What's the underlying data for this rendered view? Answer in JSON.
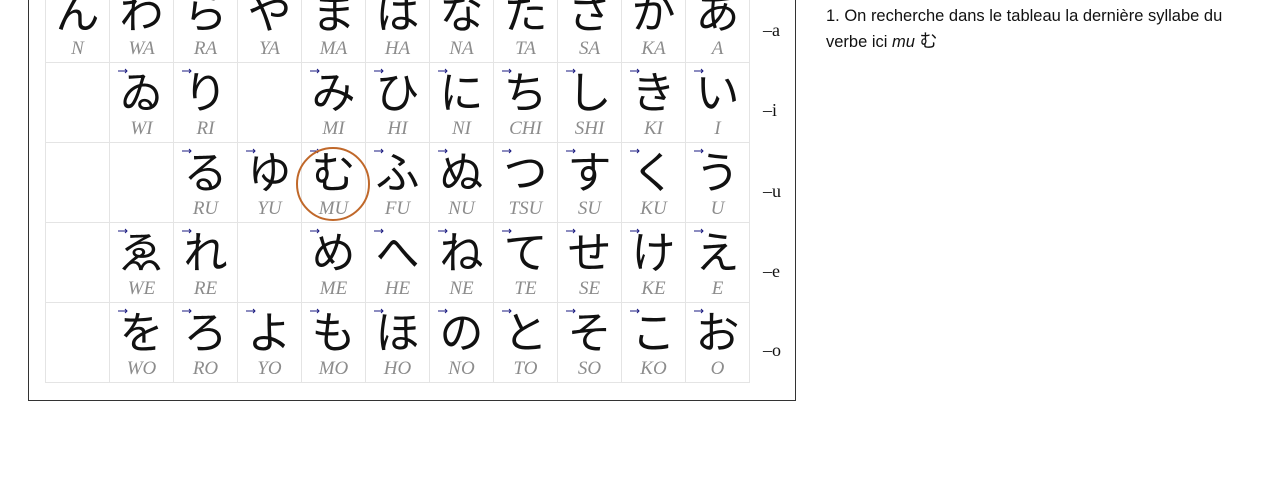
{
  "table": {
    "rows": [
      {
        "label": "–a",
        "cells": [
          {
            "kana": "ん",
            "romaji": "N"
          },
          {
            "kana": "わ",
            "romaji": "WA"
          },
          {
            "kana": "ら",
            "romaji": "RA"
          },
          {
            "kana": "や",
            "romaji": "YA"
          },
          {
            "kana": "ま",
            "romaji": "MA"
          },
          {
            "kana": "は",
            "romaji": "HA"
          },
          {
            "kana": "な",
            "romaji": "NA"
          },
          {
            "kana": "た",
            "romaji": "TA"
          },
          {
            "kana": "さ",
            "romaji": "SA"
          },
          {
            "kana": "か",
            "romaji": "KA"
          },
          {
            "kana": "あ",
            "romaji": "A"
          }
        ]
      },
      {
        "label": "–i",
        "cells": [
          {
            "kana": "",
            "romaji": ""
          },
          {
            "kana": "ゐ",
            "romaji": "WI"
          },
          {
            "kana": "り",
            "romaji": "RI"
          },
          {
            "kana": "",
            "romaji": ""
          },
          {
            "kana": "み",
            "romaji": "MI"
          },
          {
            "kana": "ひ",
            "romaji": "HI"
          },
          {
            "kana": "に",
            "romaji": "NI"
          },
          {
            "kana": "ち",
            "romaji": "CHI"
          },
          {
            "kana": "し",
            "romaji": "SHI"
          },
          {
            "kana": "き",
            "romaji": "KI"
          },
          {
            "kana": "い",
            "romaji": "I"
          }
        ]
      },
      {
        "label": "–u",
        "cells": [
          {
            "kana": "",
            "romaji": ""
          },
          {
            "kana": "",
            "romaji": ""
          },
          {
            "kana": "る",
            "romaji": "RU"
          },
          {
            "kana": "ゆ",
            "romaji": "YU"
          },
          {
            "kana": "む",
            "romaji": "MU"
          },
          {
            "kana": "ふ",
            "romaji": "FU"
          },
          {
            "kana": "ぬ",
            "romaji": "NU"
          },
          {
            "kana": "つ",
            "romaji": "TSU"
          },
          {
            "kana": "す",
            "romaji": "SU"
          },
          {
            "kana": "く",
            "romaji": "KU"
          },
          {
            "kana": "う",
            "romaji": "U"
          }
        ]
      },
      {
        "label": "–e",
        "cells": [
          {
            "kana": "",
            "romaji": ""
          },
          {
            "kana": "ゑ",
            "romaji": "WE"
          },
          {
            "kana": "れ",
            "romaji": "RE"
          },
          {
            "kana": "",
            "romaji": ""
          },
          {
            "kana": "め",
            "romaji": "ME"
          },
          {
            "kana": "へ",
            "romaji": "HE"
          },
          {
            "kana": "ね",
            "romaji": "NE"
          },
          {
            "kana": "て",
            "romaji": "TE"
          },
          {
            "kana": "せ",
            "romaji": "SE"
          },
          {
            "kana": "け",
            "romaji": "KE"
          },
          {
            "kana": "え",
            "romaji": "E"
          }
        ]
      },
      {
        "label": "–o",
        "cells": [
          {
            "kana": "",
            "romaji": ""
          },
          {
            "kana": "を",
            "romaji": "WO"
          },
          {
            "kana": "ろ",
            "romaji": "RO"
          },
          {
            "kana": "よ",
            "romaji": "YO"
          },
          {
            "kana": "も",
            "romaji": "MO"
          },
          {
            "kana": "ほ",
            "romaji": "HO"
          },
          {
            "kana": "の",
            "romaji": "NO"
          },
          {
            "kana": "と",
            "romaji": "TO"
          },
          {
            "kana": "そ",
            "romaji": "SO"
          },
          {
            "kana": "こ",
            "romaji": "KO"
          },
          {
            "kana": "お",
            "romaji": "O"
          }
        ]
      }
    ],
    "highlight": {
      "kana": "む",
      "romaji": "MU",
      "color": "#c0682a"
    }
  },
  "note": {
    "text_before": "1. On recherche dans le tableau la dernière syllabe du verbe ici ",
    "emphasis": "mu",
    "kana": "む"
  },
  "colors": {
    "kana": "#111111",
    "romaji": "#8c8c8c",
    "stroke_numbers": "#1a1a80",
    "grid_line": "#e4e4e4"
  }
}
